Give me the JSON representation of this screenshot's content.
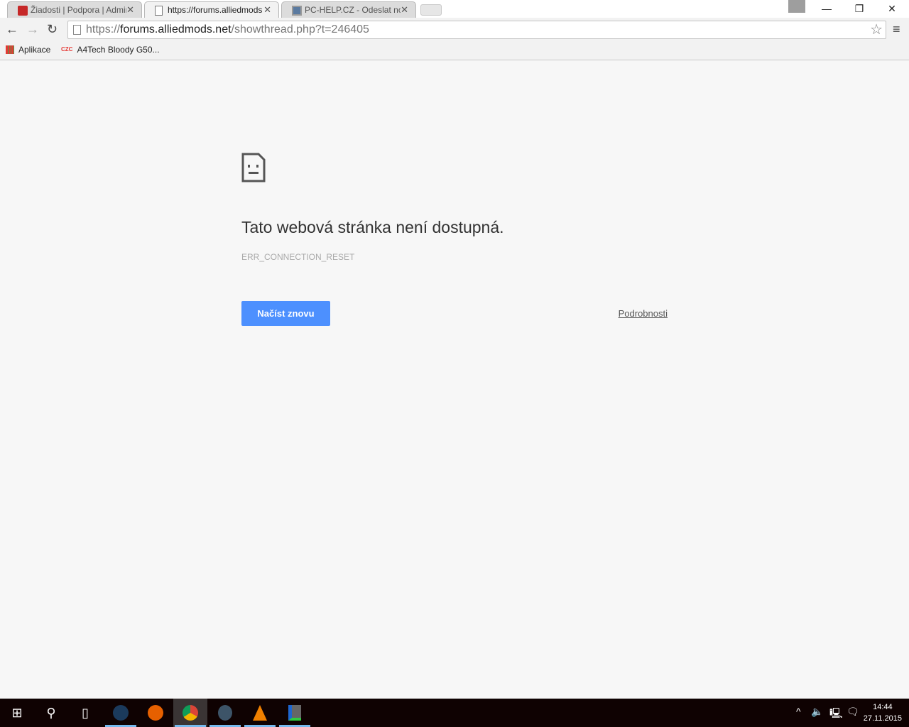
{
  "tabs": [
    {
      "title": "Žiadosti | Podpora | Admin",
      "icon": "red-site-icon",
      "active": false
    },
    {
      "title": "https://forums.alliedmods",
      "icon": "page-icon",
      "active": true
    },
    {
      "title": "PC-HELP.CZ - Odeslat nov",
      "icon": "computer-icon",
      "active": false
    }
  ],
  "window": {
    "minimize": "—",
    "restore": "❐",
    "close": "✕"
  },
  "omnibox": {
    "scheme": "https://",
    "host": "forums.alliedmods.net",
    "path": "/showthread.php?t=246405"
  },
  "bookmarks": [
    {
      "label": "Aplikace",
      "icon": "apps-grid-icon"
    },
    {
      "label": "A4Tech Bloody G50...",
      "icon": "czc-icon"
    }
  ],
  "error": {
    "title": "Tato webová stránka není dostupná.",
    "code": "ERR_CONNECTION_RESET",
    "reload_label": "Načíst znovu",
    "details_label": "Podrobnosti"
  },
  "colors": {
    "button": "#4d90fe",
    "taskbar": "#0f0202",
    "indicator": "#76b9ed"
  },
  "taskbar": {
    "apps": [
      "steam",
      "firefox",
      "chrome",
      "teamspeak",
      "vlc",
      "utility"
    ],
    "time": "14:44",
    "date": "27.11.2015"
  }
}
